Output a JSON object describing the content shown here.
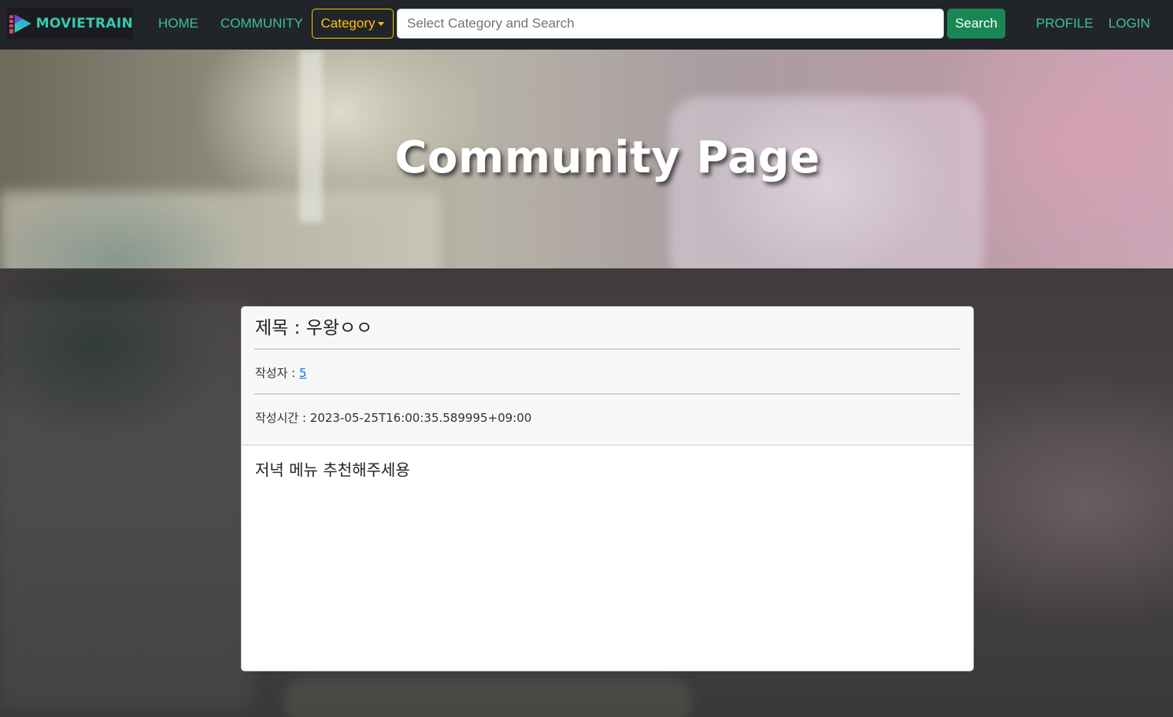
{
  "navbar": {
    "logo_text": "MOVIETRAIN",
    "home_label": "HOME",
    "community_label": "COMMUNITY",
    "category_label": "Category",
    "search_placeholder": "Select Category and Search",
    "search_value": "",
    "search_button_label": "Search",
    "profile_label": "PROFILE",
    "login_label": "LOGIN"
  },
  "hero": {
    "title": "Community Page"
  },
  "post": {
    "title_line": "제목 : 우왕ㅇㅇ",
    "author_prefix": "작성자 : ",
    "author": "5",
    "created_line": "작성시간 : 2023-05-25T16:00:35.589995+09:00",
    "content": "저녁 메뉴 추천해주세용"
  },
  "colors": {
    "navbar_bg": "#212529",
    "nav_link": "#3fbf9a",
    "category_accent": "#ffc107",
    "search_button": "#198754",
    "link_blue": "#0d6efd"
  },
  "icons": [
    "logo-play-icon",
    "caret-down-icon"
  ]
}
